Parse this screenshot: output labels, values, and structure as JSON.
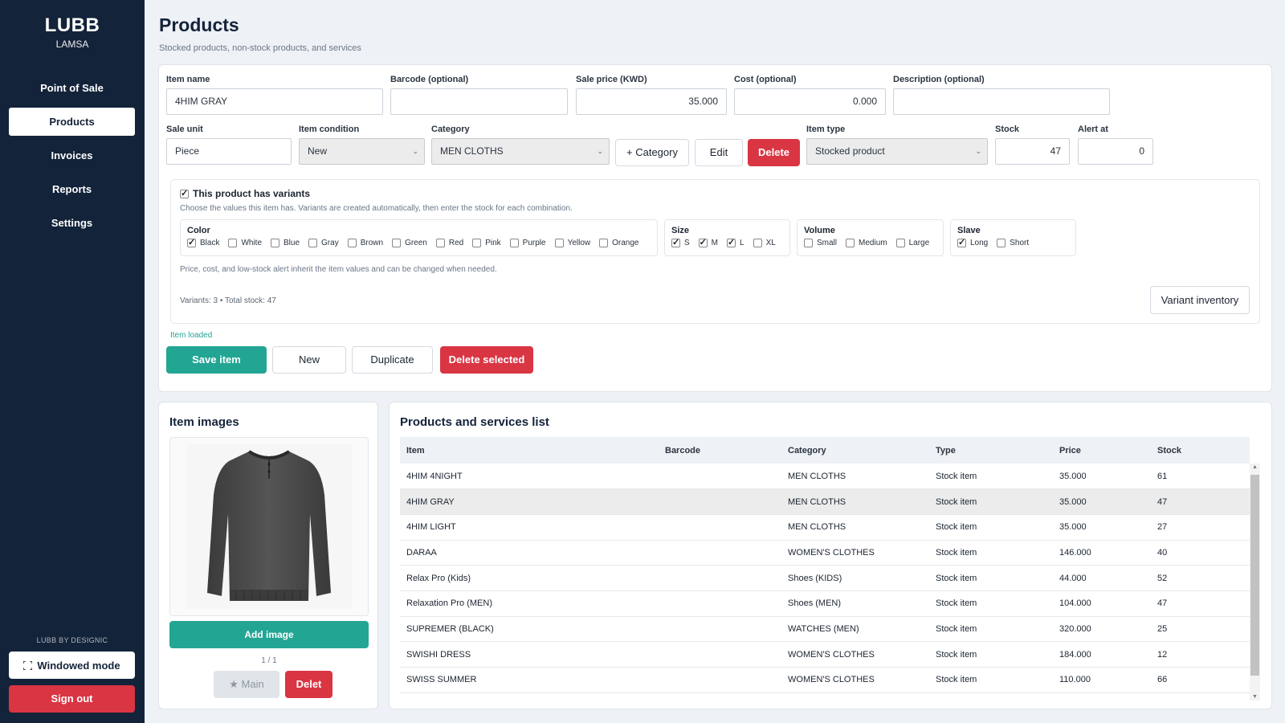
{
  "brand": {
    "name": "LUBB",
    "sub": "LAMSA"
  },
  "nav": [
    "Point of Sale",
    "Products",
    "Invoices",
    "Reports",
    "Settings"
  ],
  "footer": {
    "credit": "LUBB BY DESIGNIC",
    "windowed": "Windowed mode",
    "signout": "Sign out"
  },
  "page": {
    "title": "Products",
    "subtitle": "Stocked products, non-stock products, and services"
  },
  "form": {
    "item_name": {
      "label": "Item name",
      "value": "4HIM GRAY"
    },
    "barcode": {
      "label": "Barcode (optional)",
      "value": ""
    },
    "sale_price": {
      "label": "Sale price (KWD)",
      "value": "35.000"
    },
    "cost": {
      "label": "Cost (optional)",
      "value": "0.000"
    },
    "description": {
      "label": "Description (optional)",
      "value": ""
    },
    "sale_unit": {
      "label": "Sale unit",
      "value": "Piece"
    },
    "condition": {
      "label": "Item condition",
      "value": "New"
    },
    "category": {
      "label": "Category",
      "value": "MEN CLOTHS"
    },
    "add_category": "+ Category",
    "edit": "Edit",
    "delete": "Delete",
    "item_type": {
      "label": "Item type",
      "value": "Stocked product"
    },
    "stock": {
      "label": "Stock",
      "value": "47"
    },
    "alert": {
      "label": "Alert at",
      "value": "0"
    }
  },
  "variants": {
    "toggle_label": "This product has variants",
    "hint": "Choose the values this item has. Variants are created automatically, then enter the stock for each combination.",
    "groups": {
      "color": {
        "title": "Color",
        "options": [
          {
            "label": "Black",
            "checked": true
          },
          {
            "label": "White",
            "checked": false
          },
          {
            "label": "Blue",
            "checked": false
          },
          {
            "label": "Gray",
            "checked": false
          },
          {
            "label": "Brown",
            "checked": false
          },
          {
            "label": "Green",
            "checked": false
          },
          {
            "label": "Red",
            "checked": false
          },
          {
            "label": "Pink",
            "checked": false
          },
          {
            "label": "Purple",
            "checked": false
          },
          {
            "label": "Yellow",
            "checked": false
          },
          {
            "label": "Orange",
            "checked": false
          }
        ]
      },
      "size": {
        "title": "Size",
        "options": [
          {
            "label": "S",
            "checked": true
          },
          {
            "label": "M",
            "checked": true
          },
          {
            "label": "L",
            "checked": true
          },
          {
            "label": "XL",
            "checked": false
          }
        ]
      },
      "volume": {
        "title": "Volume",
        "options": [
          {
            "label": "Small",
            "checked": false
          },
          {
            "label": "Medium",
            "checked": false
          },
          {
            "label": "Large",
            "checked": false
          }
        ]
      },
      "slave": {
        "title": "Slave",
        "options": [
          {
            "label": "Long",
            "checked": true
          },
          {
            "label": "Short",
            "checked": false
          }
        ]
      }
    },
    "inherit_note": "Price, cost, and low-stock alert inherit the item values and can be changed when needed.",
    "summary": "Variants: 3 • Total stock: 47",
    "inventory_button": "Variant inventory"
  },
  "status": "Item loaded",
  "actions": {
    "save": "Save item",
    "new": "New",
    "duplicate": "Duplicate",
    "delete_selected": "Delete selected"
  },
  "images": {
    "title": "Item images",
    "add": "Add image",
    "counter": "1 / 1",
    "main": "★ Main",
    "delete": "Delet"
  },
  "list": {
    "title": "Products and services list",
    "columns": [
      "Item",
      "Barcode",
      "Category",
      "Type",
      "Price",
      "Stock"
    ],
    "rows": [
      [
        "4HIM 4NIGHT",
        "",
        "MEN CLOTHS",
        "Stock item",
        "35.000",
        "61"
      ],
      [
        "4HIM GRAY",
        "",
        "MEN CLOTHS",
        "Stock item",
        "35.000",
        "47"
      ],
      [
        "4HIM LIGHT",
        "",
        "MEN CLOTHS",
        "Stock item",
        "35.000",
        "27"
      ],
      [
        "DARAA",
        "",
        "WOMEN'S CLOTHES",
        "Stock item",
        "146.000",
        "40"
      ],
      [
        "Relax Pro (Kids)",
        "",
        "Shoes (KIDS)",
        "Stock item",
        "44.000",
        "52"
      ],
      [
        "Relaxation Pro (MEN)",
        "",
        "Shoes (MEN)",
        "Stock item",
        "104.000",
        "47"
      ],
      [
        "SUPREMER (BLACK)",
        "",
        "WATCHES (MEN)",
        "Stock item",
        "320.000",
        "25"
      ],
      [
        "SWISHI DRESS",
        "",
        "WOMEN'S CLOTHES",
        "Stock item",
        "184.000",
        "12"
      ],
      [
        "SWISS SUMMER",
        "",
        "WOMEN'S CLOTHES",
        "Stock item",
        "110.000",
        "66"
      ]
    ],
    "selected_row": 1
  }
}
